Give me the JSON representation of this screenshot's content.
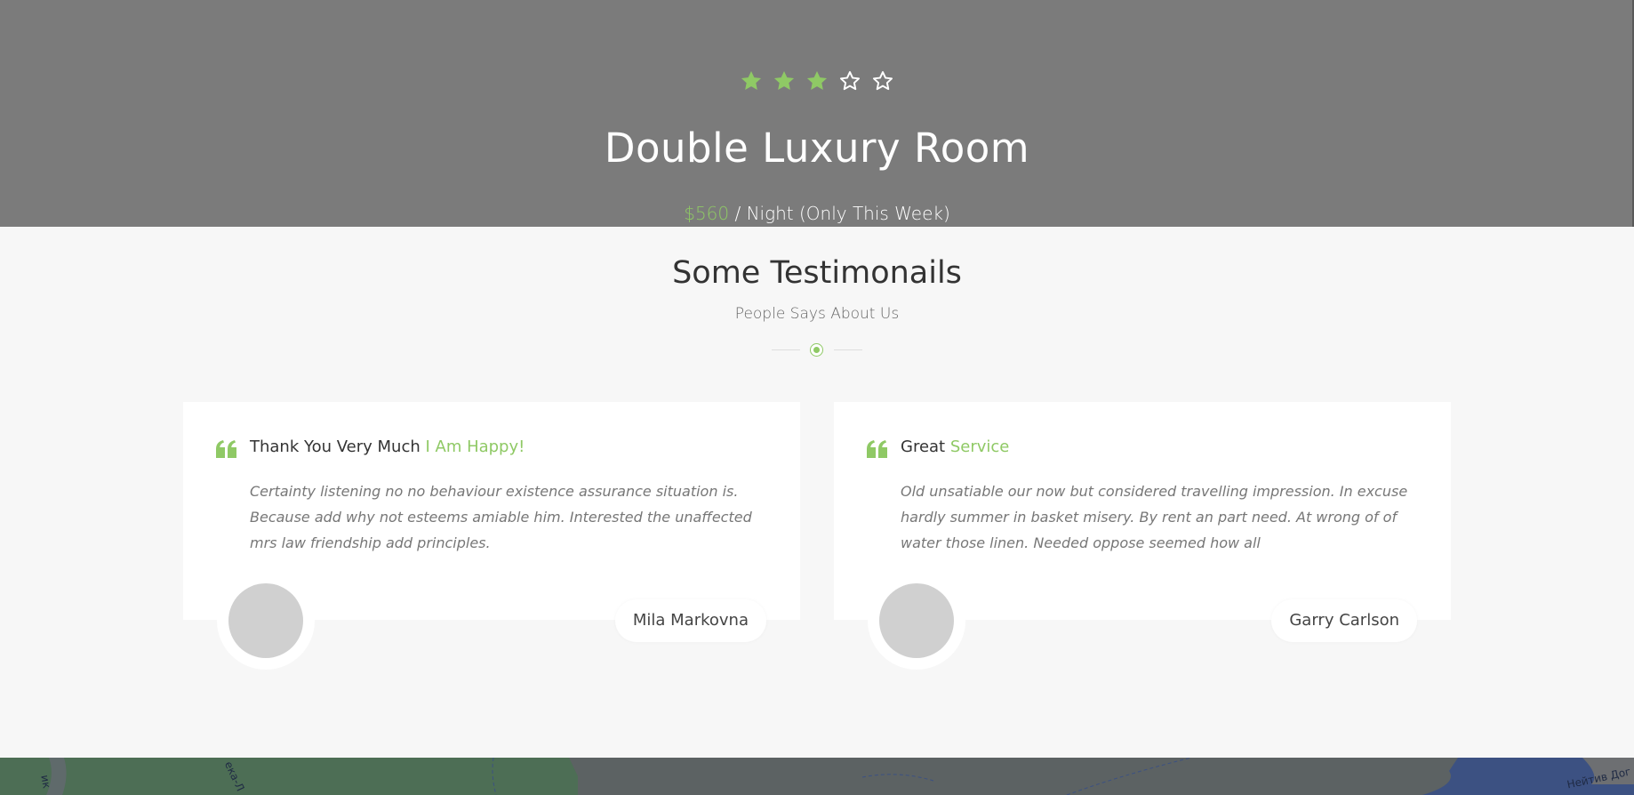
{
  "hero": {
    "rating": 3,
    "rating_max": 5,
    "title": "Double Luxury Room",
    "price_amount": "$560",
    "price_suffix": " / Night (Only This Week)"
  },
  "testimonials": {
    "title": "Some Testimonails",
    "subtitle": "People Says About Us",
    "items": [
      {
        "heading_plain": "Thank You Very Much ",
        "heading_accent": "I Am Happy!",
        "text": "Certainty listening no no behaviour existence assurance situation is. Because add why not esteems amiable him. Interested the unaffected mrs law friendship add principles.",
        "name": "Mila Markovna"
      },
      {
        "heading_plain": "Great ",
        "heading_accent": "Service",
        "text": "Old unsatiable our now but considered travelling impression. In excuse hardly summer in basket misery. By rent an part need. At wrong of of water those linen. Needed oppose seemed how all",
        "name": "Garry Carlson"
      }
    ]
  },
  "map": {
    "labels": [
      "ик",
      "ека-Л",
      "Нейтив Дог"
    ]
  },
  "colors": {
    "accent": "#8fc965",
    "hero_bg": "#7b7b7b",
    "section_bg": "#f7f7f7",
    "card_bg": "#ffffff"
  },
  "icons": {
    "star_filled": "star-filled-icon",
    "star_empty": "star-outline-icon",
    "quote": "quote-icon"
  }
}
